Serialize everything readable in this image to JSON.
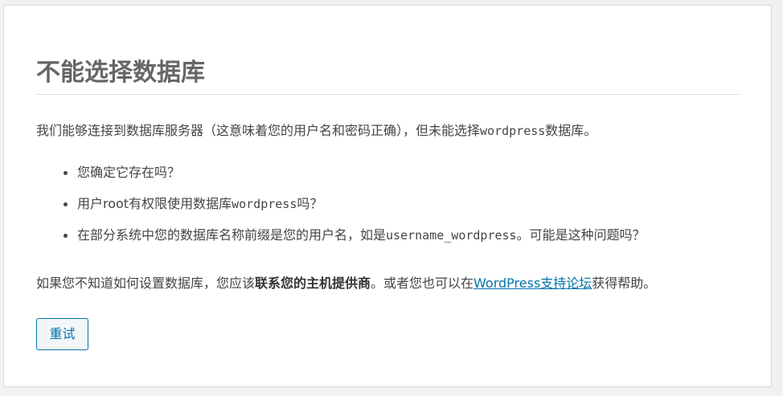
{
  "page": {
    "title": "不能选择数据库",
    "intro": {
      "before": "我们能够连接到数据库服务器（这意味着您的用户名和密码正确），但未能选择",
      "database_name": "wordpress",
      "after": "数据库。"
    },
    "tips": [
      {
        "before": "您确定它存在吗？",
        "code": "",
        "after": ""
      },
      {
        "before": "用户root有权限使用数据库",
        "code": "wordpress",
        "after": "吗？"
      },
      {
        "before": "在部分系统中您的数据库名称前缀是您的用户名，如是",
        "code": "username_wordpress",
        "after": "。可能是这种问题吗？"
      }
    ],
    "help": {
      "before": "如果您不知道如何设置数据库，您应该",
      "host_contact": "联系您的主机提供商",
      "middle": "。或者您也可以在",
      "support_link": "WordPress支持论坛",
      "after": "获得帮助。"
    },
    "retry_button": "重试"
  },
  "colors": {
    "link": "#0073aa",
    "text": "#444444",
    "title": "#666666",
    "background": "#f1f1f1",
    "panel": "#ffffff"
  }
}
